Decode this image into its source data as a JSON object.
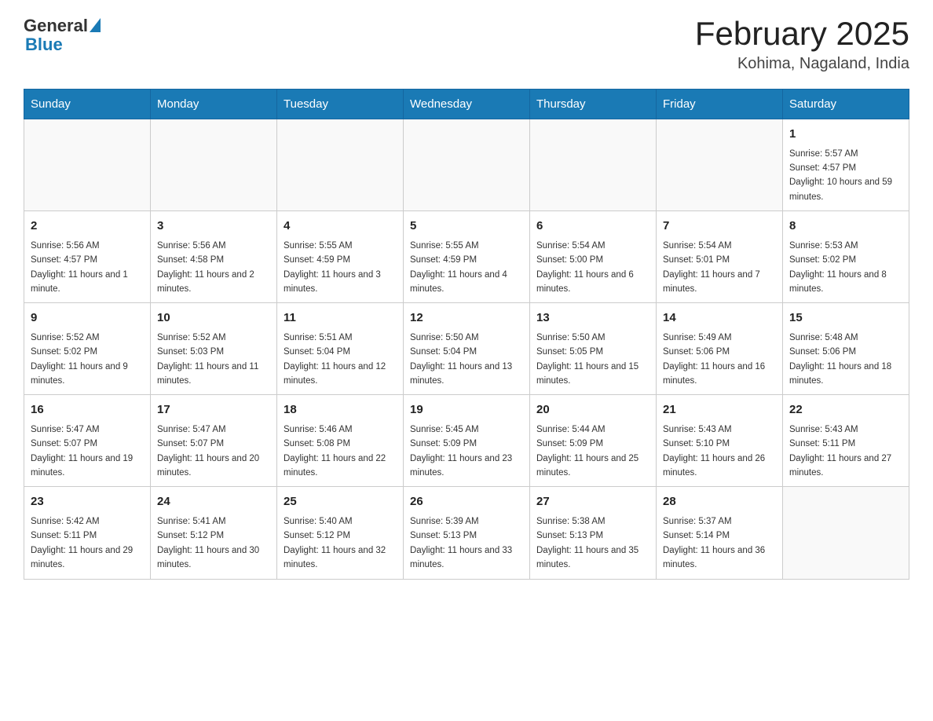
{
  "header": {
    "logo_general": "General",
    "logo_blue": "Blue",
    "month_title": "February 2025",
    "location": "Kohima, Nagaland, India"
  },
  "days_of_week": [
    "Sunday",
    "Monday",
    "Tuesday",
    "Wednesday",
    "Thursday",
    "Friday",
    "Saturday"
  ],
  "weeks": [
    {
      "days": [
        {
          "num": "",
          "sunrise": "",
          "sunset": "",
          "daylight": ""
        },
        {
          "num": "",
          "sunrise": "",
          "sunset": "",
          "daylight": ""
        },
        {
          "num": "",
          "sunrise": "",
          "sunset": "",
          "daylight": ""
        },
        {
          "num": "",
          "sunrise": "",
          "sunset": "",
          "daylight": ""
        },
        {
          "num": "",
          "sunrise": "",
          "sunset": "",
          "daylight": ""
        },
        {
          "num": "",
          "sunrise": "",
          "sunset": "",
          "daylight": ""
        },
        {
          "num": "1",
          "sunrise": "Sunrise: 5:57 AM",
          "sunset": "Sunset: 4:57 PM",
          "daylight": "Daylight: 10 hours and 59 minutes."
        }
      ]
    },
    {
      "days": [
        {
          "num": "2",
          "sunrise": "Sunrise: 5:56 AM",
          "sunset": "Sunset: 4:57 PM",
          "daylight": "Daylight: 11 hours and 1 minute."
        },
        {
          "num": "3",
          "sunrise": "Sunrise: 5:56 AM",
          "sunset": "Sunset: 4:58 PM",
          "daylight": "Daylight: 11 hours and 2 minutes."
        },
        {
          "num": "4",
          "sunrise": "Sunrise: 5:55 AM",
          "sunset": "Sunset: 4:59 PM",
          "daylight": "Daylight: 11 hours and 3 minutes."
        },
        {
          "num": "5",
          "sunrise": "Sunrise: 5:55 AM",
          "sunset": "Sunset: 4:59 PM",
          "daylight": "Daylight: 11 hours and 4 minutes."
        },
        {
          "num": "6",
          "sunrise": "Sunrise: 5:54 AM",
          "sunset": "Sunset: 5:00 PM",
          "daylight": "Daylight: 11 hours and 6 minutes."
        },
        {
          "num": "7",
          "sunrise": "Sunrise: 5:54 AM",
          "sunset": "Sunset: 5:01 PM",
          "daylight": "Daylight: 11 hours and 7 minutes."
        },
        {
          "num": "8",
          "sunrise": "Sunrise: 5:53 AM",
          "sunset": "Sunset: 5:02 PM",
          "daylight": "Daylight: 11 hours and 8 minutes."
        }
      ]
    },
    {
      "days": [
        {
          "num": "9",
          "sunrise": "Sunrise: 5:52 AM",
          "sunset": "Sunset: 5:02 PM",
          "daylight": "Daylight: 11 hours and 9 minutes."
        },
        {
          "num": "10",
          "sunrise": "Sunrise: 5:52 AM",
          "sunset": "Sunset: 5:03 PM",
          "daylight": "Daylight: 11 hours and 11 minutes."
        },
        {
          "num": "11",
          "sunrise": "Sunrise: 5:51 AM",
          "sunset": "Sunset: 5:04 PM",
          "daylight": "Daylight: 11 hours and 12 minutes."
        },
        {
          "num": "12",
          "sunrise": "Sunrise: 5:50 AM",
          "sunset": "Sunset: 5:04 PM",
          "daylight": "Daylight: 11 hours and 13 minutes."
        },
        {
          "num": "13",
          "sunrise": "Sunrise: 5:50 AM",
          "sunset": "Sunset: 5:05 PM",
          "daylight": "Daylight: 11 hours and 15 minutes."
        },
        {
          "num": "14",
          "sunrise": "Sunrise: 5:49 AM",
          "sunset": "Sunset: 5:06 PM",
          "daylight": "Daylight: 11 hours and 16 minutes."
        },
        {
          "num": "15",
          "sunrise": "Sunrise: 5:48 AM",
          "sunset": "Sunset: 5:06 PM",
          "daylight": "Daylight: 11 hours and 18 minutes."
        }
      ]
    },
    {
      "days": [
        {
          "num": "16",
          "sunrise": "Sunrise: 5:47 AM",
          "sunset": "Sunset: 5:07 PM",
          "daylight": "Daylight: 11 hours and 19 minutes."
        },
        {
          "num": "17",
          "sunrise": "Sunrise: 5:47 AM",
          "sunset": "Sunset: 5:07 PM",
          "daylight": "Daylight: 11 hours and 20 minutes."
        },
        {
          "num": "18",
          "sunrise": "Sunrise: 5:46 AM",
          "sunset": "Sunset: 5:08 PM",
          "daylight": "Daylight: 11 hours and 22 minutes."
        },
        {
          "num": "19",
          "sunrise": "Sunrise: 5:45 AM",
          "sunset": "Sunset: 5:09 PM",
          "daylight": "Daylight: 11 hours and 23 minutes."
        },
        {
          "num": "20",
          "sunrise": "Sunrise: 5:44 AM",
          "sunset": "Sunset: 5:09 PM",
          "daylight": "Daylight: 11 hours and 25 minutes."
        },
        {
          "num": "21",
          "sunrise": "Sunrise: 5:43 AM",
          "sunset": "Sunset: 5:10 PM",
          "daylight": "Daylight: 11 hours and 26 minutes."
        },
        {
          "num": "22",
          "sunrise": "Sunrise: 5:43 AM",
          "sunset": "Sunset: 5:11 PM",
          "daylight": "Daylight: 11 hours and 27 minutes."
        }
      ]
    },
    {
      "days": [
        {
          "num": "23",
          "sunrise": "Sunrise: 5:42 AM",
          "sunset": "Sunset: 5:11 PM",
          "daylight": "Daylight: 11 hours and 29 minutes."
        },
        {
          "num": "24",
          "sunrise": "Sunrise: 5:41 AM",
          "sunset": "Sunset: 5:12 PM",
          "daylight": "Daylight: 11 hours and 30 minutes."
        },
        {
          "num": "25",
          "sunrise": "Sunrise: 5:40 AM",
          "sunset": "Sunset: 5:12 PM",
          "daylight": "Daylight: 11 hours and 32 minutes."
        },
        {
          "num": "26",
          "sunrise": "Sunrise: 5:39 AM",
          "sunset": "Sunset: 5:13 PM",
          "daylight": "Daylight: 11 hours and 33 minutes."
        },
        {
          "num": "27",
          "sunrise": "Sunrise: 5:38 AM",
          "sunset": "Sunset: 5:13 PM",
          "daylight": "Daylight: 11 hours and 35 minutes."
        },
        {
          "num": "28",
          "sunrise": "Sunrise: 5:37 AM",
          "sunset": "Sunset: 5:14 PM",
          "daylight": "Daylight: 11 hours and 36 minutes."
        },
        {
          "num": "",
          "sunrise": "",
          "sunset": "",
          "daylight": ""
        }
      ]
    }
  ]
}
